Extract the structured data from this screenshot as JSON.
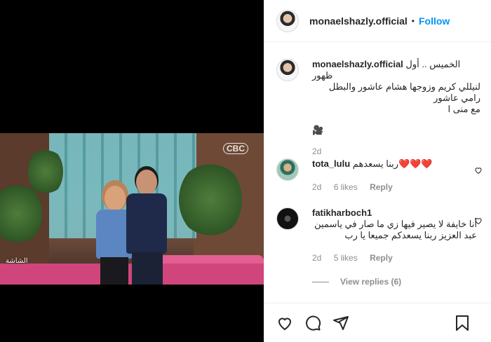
{
  "post_author": {
    "username": "monaelshazly.official",
    "follow_label": "Follow",
    "separator": "•"
  },
  "caption": {
    "username": "monaelshazly.official",
    "line1": "الخميس .. أول ظهور",
    "line2": "لنيللي كريم وزوجها هشام عاشور والبطل رامي عاشور",
    "line3": "مع منى ا",
    "line4": "🎥",
    "time": "2d"
  },
  "video": {
    "logo_text": "الشاشة",
    "channel_text": "CBC"
  },
  "comments": [
    {
      "username": "tota_lulu",
      "text": "ربنا يسعدهم❤️❤️❤️",
      "time": "2d",
      "likes": "6 likes",
      "reply_label": "Reply"
    },
    {
      "username": "fatikharboch1",
      "text": "أنا خايفة لا يصير فيها زي ما صار في ياسمين عبد العزيز ربنا يسعدكم جميعا يا رب",
      "time": "2d",
      "likes": "5 likes",
      "reply_label": "Reply",
      "view_replies": "View replies (6)"
    }
  ],
  "icons": {
    "like": "heart-icon",
    "comment": "comment-icon",
    "share": "share-icon",
    "save": "bookmark-icon"
  }
}
